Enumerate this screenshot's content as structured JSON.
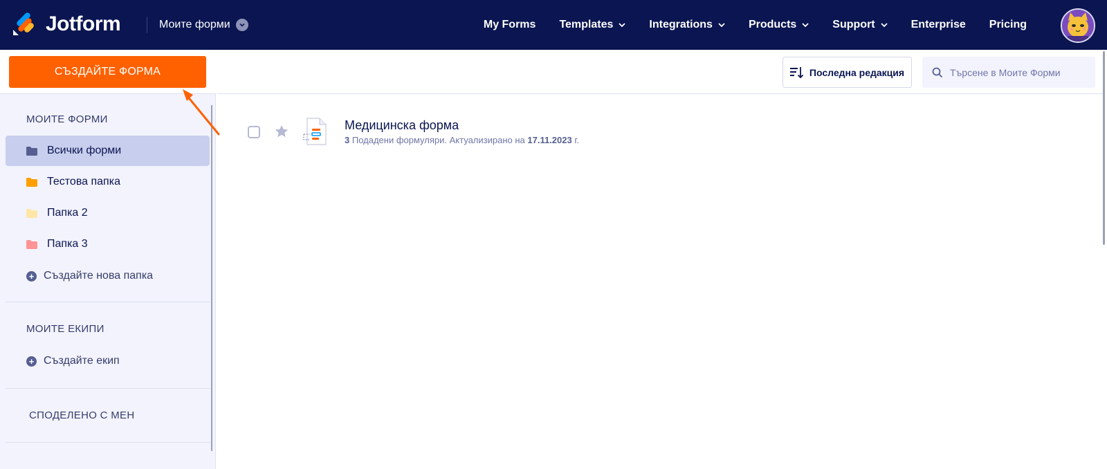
{
  "header": {
    "brand": "Jotform",
    "switcher_label": "Моите форми",
    "nav": [
      {
        "label": "My Forms",
        "dropdown": false
      },
      {
        "label": "Templates",
        "dropdown": true
      },
      {
        "label": "Integrations",
        "dropdown": true
      },
      {
        "label": "Products",
        "dropdown": true
      },
      {
        "label": "Support",
        "dropdown": true
      },
      {
        "label": "Enterprise",
        "dropdown": false
      },
      {
        "label": "Pricing",
        "dropdown": false
      }
    ]
  },
  "sidebar": {
    "create_button": "СЪЗДАЙТЕ ФОРМА",
    "my_forms_title": "МОИТЕ ФОРМИ",
    "folders": [
      {
        "label": "Всички форми",
        "color": "#555f91",
        "active": true
      },
      {
        "label": "Тестова папка",
        "color": "#ff9f00",
        "active": false
      },
      {
        "label": "Папка 2",
        "color": "#ffe6a6",
        "active": false
      },
      {
        "label": "Папка 3",
        "color": "#ff9494",
        "active": false
      }
    ],
    "create_folder": "Създайте нова папка",
    "teams_title": "МОИТЕ ЕКИПИ",
    "create_team": "Създайте екип",
    "shared_title": "СПОДЕЛЕНО С МЕН"
  },
  "toolbar": {
    "sort_label": "Последна редакция",
    "search_placeholder": "Търсене в Моите Форми"
  },
  "forms": [
    {
      "title": "Медицинска форма",
      "submissions_count": "3",
      "submissions_text": " Подадени формуляри. Актуализирано на ",
      "updated_date": "17.11.2023",
      "date_suffix": " г.",
      "starred": false
    }
  ],
  "colors": {
    "nav_bg": "#0a1551",
    "accent": "#ff6100",
    "sidebar_bg": "#f3f3fe",
    "active_item": "#c8ceed"
  }
}
